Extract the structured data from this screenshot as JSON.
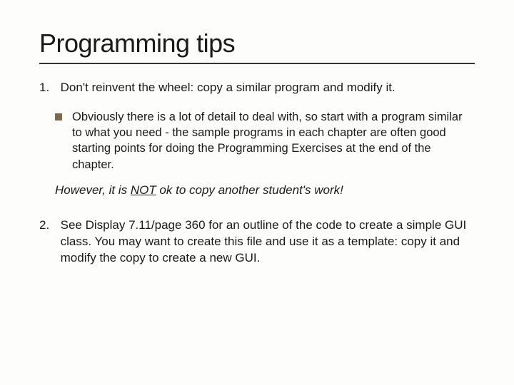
{
  "title": "Programming tips",
  "items": [
    {
      "num": "1.",
      "text": "Don't reinvent the wheel: copy a similar program and modify it.",
      "sub": "Obviously there is a lot of detail to deal with, so start with a program similar to what you need - the sample programs in each chapter are often good starting points for doing the Programming Exercises at the end of the chapter."
    },
    {
      "num": "2.",
      "text": "See Display 7.11/page 360 for an outline of the code to create a simple GUI class.  You may want to create this file and use it as a template: copy it and modify the copy to create a new GUI."
    }
  ],
  "note_prefix": "However, it is ",
  "note_emph": "NOT",
  "note_suffix": " ok to copy another student's work!"
}
